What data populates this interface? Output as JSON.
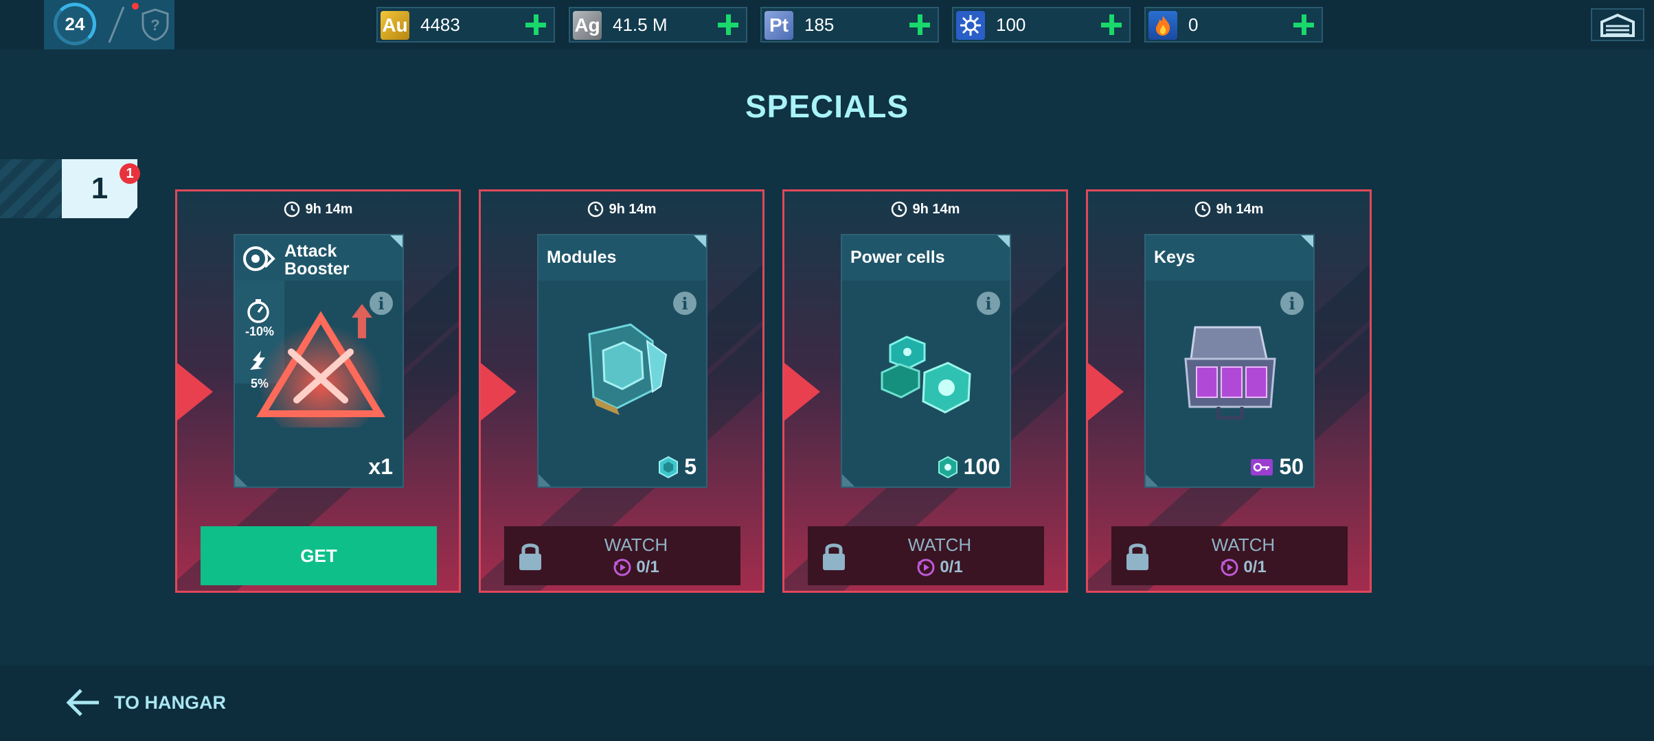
{
  "topbar": {
    "level": "24",
    "currencies": [
      {
        "name": "gold",
        "icon_label": "Au",
        "value": "4483",
        "color": "#d8a21c"
      },
      {
        "name": "silver",
        "icon_label": "Ag",
        "value": "41.5 M",
        "color": "#8b8f93"
      },
      {
        "name": "platinum",
        "icon_label": "Pt",
        "value": "185",
        "color": "#5a7fc4"
      },
      {
        "name": "component",
        "icon_label": "",
        "value": "100",
        "color": "#2a5fc8"
      },
      {
        "name": "fire",
        "icon_label": "",
        "value": "0",
        "color": "#e8552a"
      }
    ]
  },
  "title": "SPECIALS",
  "page": {
    "number": "1",
    "badge": "1"
  },
  "cards": [
    {
      "timer": "9h 14m",
      "title_line1": "Attack",
      "title_line2": "Booster",
      "stat1": "-10%",
      "stat2": "5%",
      "amount": "x1",
      "action": "GET"
    },
    {
      "timer": "9h 14m",
      "title": "Modules",
      "amount": "5",
      "action": "WATCH",
      "progress": "0/1"
    },
    {
      "timer": "9h 14m",
      "title": "Power cells",
      "amount": "100",
      "action": "WATCH",
      "progress": "0/1"
    },
    {
      "timer": "9h 14m",
      "title": "Keys",
      "amount": "50",
      "action": "WATCH",
      "progress": "0/1"
    }
  ],
  "footer": {
    "back_label": "TO HANGAR"
  },
  "colors": {
    "accent_green": "#0fbf8a",
    "card_border": "#e0485a",
    "plus_green": "#19d96a"
  }
}
